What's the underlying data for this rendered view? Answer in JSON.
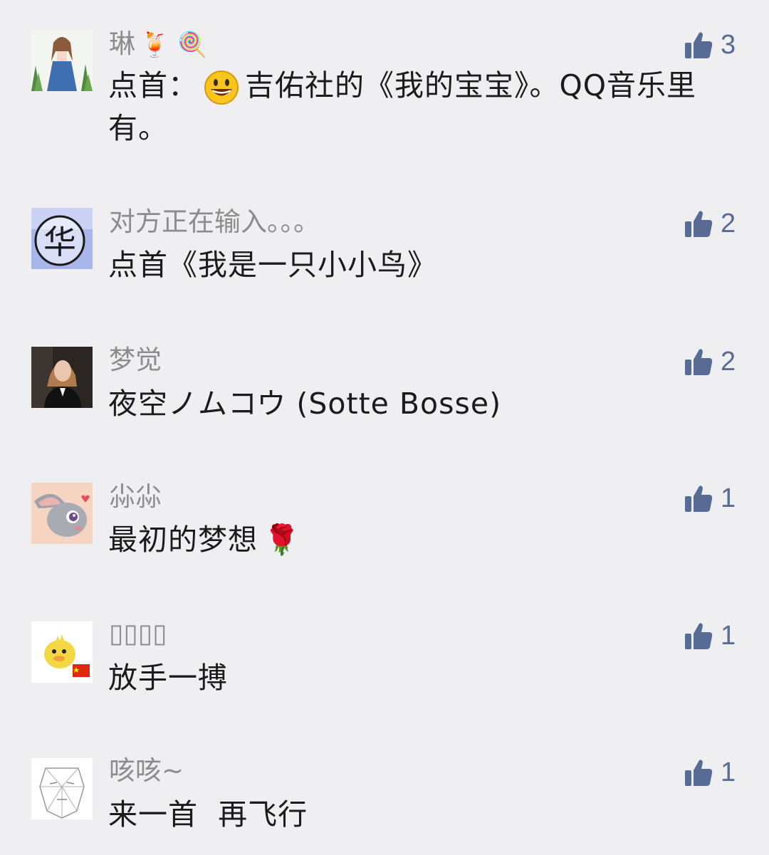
{
  "comments": [
    {
      "nickname": "琳",
      "nickname_emojis": "🍹 🍭",
      "text_before_emoji": "点首：",
      "inline_emoji": "grinning-face-emoji",
      "text_after_emoji": "吉佑社的《我的宝宝》。QQ音乐里有。",
      "likes": "3",
      "avatar_icon": "girl-in-blue-dress-avatar"
    },
    {
      "nickname": "对方正在输入。。。",
      "text": "点首《我是一只小小鸟》",
      "likes": "2",
      "avatar_icon": "hua-character-seal-avatar"
    },
    {
      "nickname": "梦觉",
      "text": "夜空ノムコウ (Sotte Bosse)",
      "likes": "2",
      "avatar_icon": "woman-portrait-avatar"
    },
    {
      "nickname": "尛尛",
      "text": "最初的梦想",
      "text_emoji": "🌹",
      "likes": "1",
      "avatar_icon": "bunny-cartoon-avatar"
    },
    {
      "nickname": "▯▯▯▯",
      "text": "放手一搏",
      "likes": "1",
      "avatar_icon": "yellow-duck-flag-avatar"
    },
    {
      "nickname": "咳咳~",
      "text": "来一首  再飞行",
      "likes": "1",
      "avatar_icon": "face-line-drawing-avatar"
    }
  ],
  "colors": {
    "background": "#efeff1",
    "nickname": "#8c8c8c",
    "text": "#1b1b1b",
    "like_accent": "#576b95"
  },
  "icons": {
    "like": "thumbs-up-icon"
  }
}
